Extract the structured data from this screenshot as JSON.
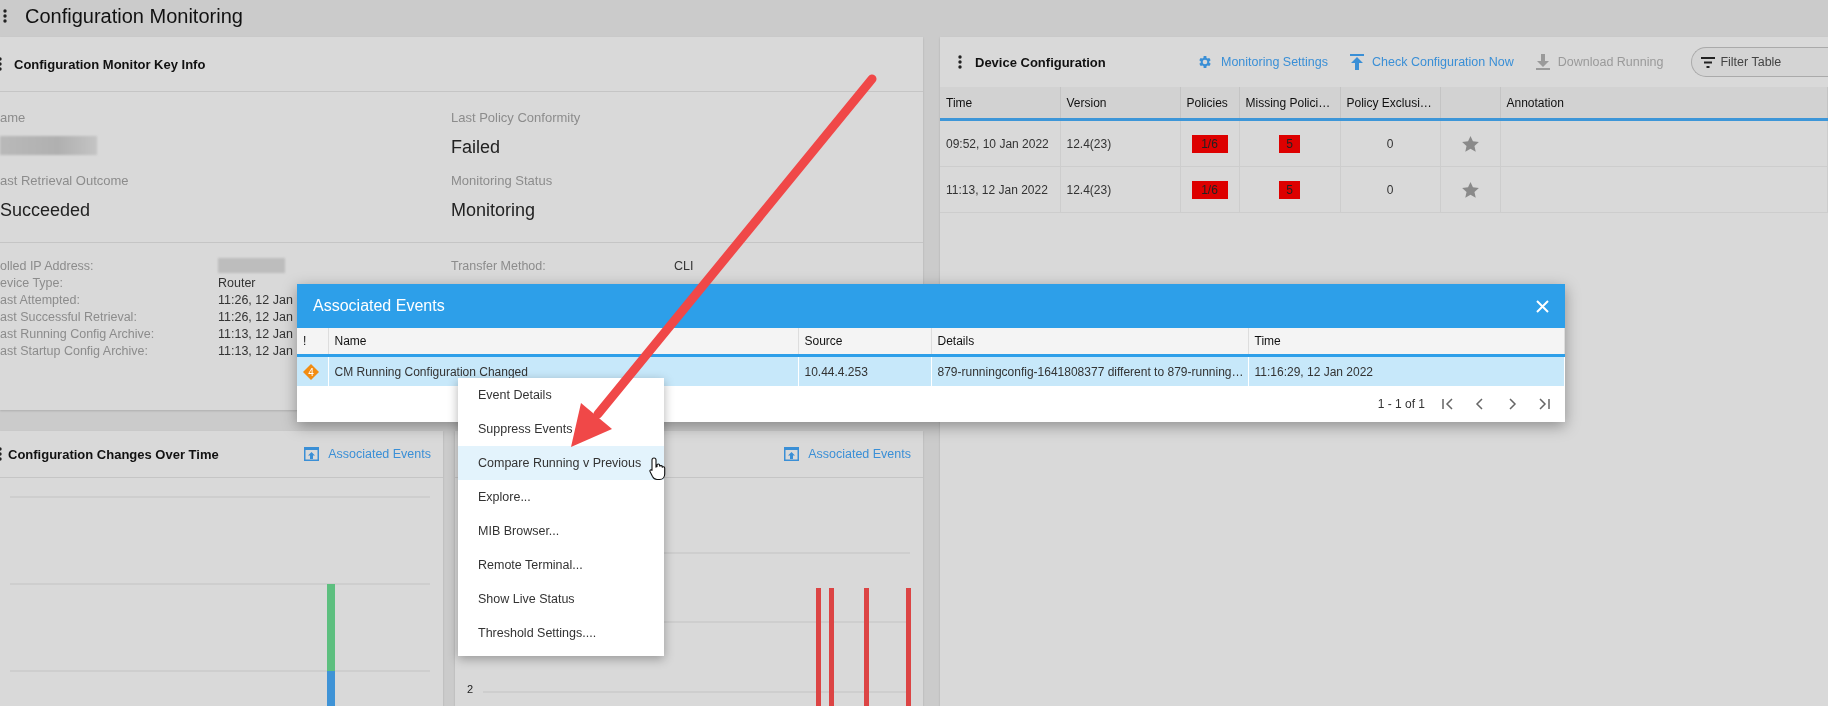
{
  "app_title": "Configuration Monitoring",
  "key_info": {
    "title": "Configuration Monitor Key Info",
    "summary": [
      [
        {
          "label": "ame",
          "kind": "redacted"
        },
        {
          "label": "ast Retrieval Outcome",
          "kind": "text",
          "value": "Succeeded"
        }
      ],
      [
        {
          "label": "Last Policy Conformity",
          "kind": "text",
          "value": "Failed"
        },
        {
          "label": "Monitoring Status",
          "kind": "text",
          "value": "Monitoring"
        }
      ]
    ],
    "details": [
      [
        {
          "label": "olled IP Address:",
          "kind": "redacted"
        },
        {
          "label": "evice Type:",
          "kind": "text",
          "value": "Router"
        },
        {
          "label": "ast Attempted:",
          "kind": "text",
          "value": "11:26, 12 Jan"
        },
        {
          "label": "ast Successful Retrieval:",
          "kind": "text",
          "value": "11:26, 12 Jan"
        },
        {
          "label": "ast Running Config Archive:",
          "kind": "text",
          "value": "11:13, 12 Jan"
        },
        {
          "label": "ast Startup Config Archive:",
          "kind": "text",
          "value": "11:13, 12 Jan"
        }
      ],
      [
        {
          "label": "Transfer Method:",
          "kind": "text",
          "value": "CLI"
        }
      ]
    ]
  },
  "device_config": {
    "title": "Device Configuration",
    "actions": [
      {
        "label": "Monitoring Settings",
        "kind": "gear",
        "disabled": false
      },
      {
        "label": "Check Configuration Now",
        "kind": "upload",
        "disabled": false
      },
      {
        "label": "Download Running",
        "kind": "download",
        "disabled": true
      }
    ],
    "filter": {
      "placeholder": "Filter Table"
    },
    "columns": [
      {
        "label": "Time",
        "kind": "text"
      },
      {
        "label": "Version",
        "kind": "text"
      },
      {
        "label": "Policies",
        "kind": "badge"
      },
      {
        "label": "Missing Polici…",
        "kind": "badge"
      },
      {
        "label": "Policy Exclusi…",
        "kind": "number"
      },
      {
        "kind": "star"
      },
      {
        "label": "Annotation",
        "kind": "text"
      }
    ],
    "rows": [
      {
        "cells": [
          "09:52, 10 Jan 2022",
          "12.4(23)",
          "1/6",
          "5",
          "0"
        ]
      },
      {
        "cells": [
          "11:13, 12 Jan 2022",
          "12.4(23)",
          "1/6",
          "5",
          "0"
        ]
      }
    ]
  },
  "chart_panels": [
    {
      "kind": "stacked",
      "title": "Configuration Changes Over Time",
      "link": "Associated Events"
    },
    {
      "kind": "spikes",
      "link": "Associated Events",
      "axis_label": "2"
    }
  ],
  "events_dialog": {
    "title": "Associated Events",
    "columns": [
      {
        "label": "!",
        "kind": "severity"
      },
      {
        "label": "Name",
        "kind": "text"
      },
      {
        "label": "Source",
        "kind": "text"
      },
      {
        "label": "Details",
        "kind": "text"
      },
      {
        "label": "Time",
        "kind": "text"
      }
    ],
    "rows": [
      {
        "cells": [
          "4",
          "CM Running Configuration Changed",
          "10.44.4.253",
          "879-runningconfig-1641808377 different to 879-running…",
          "11:16:29, 12 Jan 2022"
        ],
        "selected": true
      }
    ],
    "pagination": "1 - 1 of 1"
  },
  "context_menu": {
    "items": [
      {
        "label": "Event Details",
        "selected": false
      },
      {
        "label": "Suppress Events",
        "selected": false
      },
      {
        "label": "Compare Running v Previous",
        "selected": true
      },
      {
        "label": "Explore...",
        "selected": false
      },
      {
        "label": "MIB Browser...",
        "selected": false
      },
      {
        "label": "Remote Terminal...",
        "selected": false
      },
      {
        "label": "Show Live Status",
        "selected": false
      },
      {
        "label": "Threshold Settings....",
        "selected": false
      }
    ]
  }
}
